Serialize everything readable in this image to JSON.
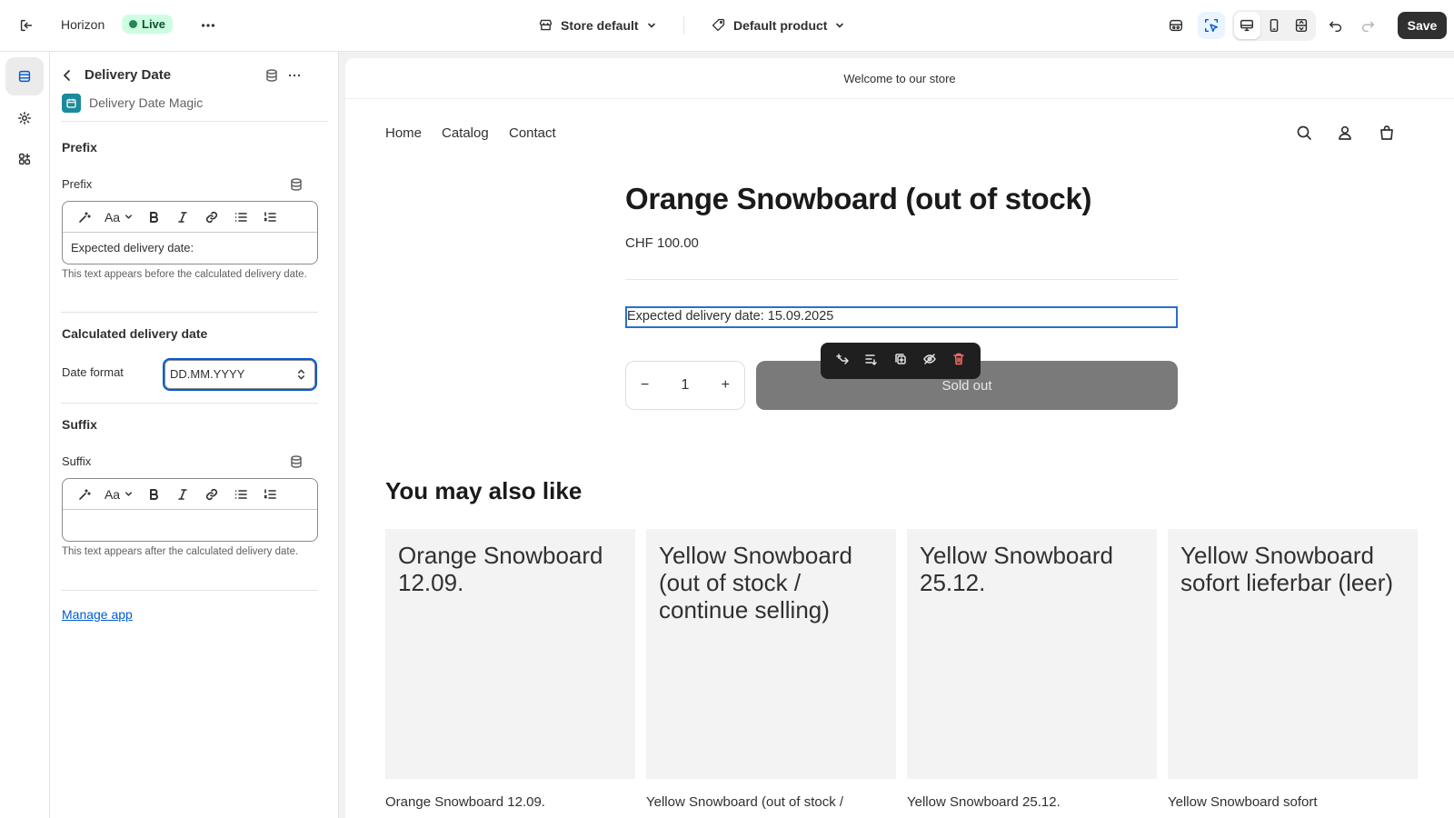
{
  "topbar": {
    "store_name": "Horizon",
    "status": "Live",
    "store_selector": "Store default",
    "template_selector": "Default product",
    "save_label": "Save"
  },
  "panel": {
    "title": "Delivery Date",
    "app_name": "Delivery Date Magic",
    "prefix": {
      "section_title": "Prefix",
      "field_label": "Prefix",
      "value": "Expected delivery date:",
      "help": "This text appears before the calculated delivery date."
    },
    "calculated": {
      "section_title": "Calculated delivery date",
      "field_label": "Date format",
      "value": "DD.MM.YYYY"
    },
    "suffix": {
      "section_title": "Suffix",
      "field_label": "Suffix",
      "value": "",
      "help": "This text appears after the calculated delivery date."
    },
    "manage_link": "Manage app"
  },
  "preview": {
    "announcement": "Welcome to our store",
    "nav": [
      "Home",
      "Catalog",
      "Contact"
    ],
    "product_title": "Orange Snowboard (out of stock)",
    "price": "CHF 100.00",
    "delivery_text": "Expected delivery date:  15.09.2025",
    "quantity": "1",
    "qty_minus": "−",
    "qty_plus": "+",
    "sold_out_label": "Sold out",
    "related_title": "You may also like",
    "products": [
      {
        "image_text": "Orange Snowboard 12.09.",
        "name": "Orange Snowboard 12.09."
      },
      {
        "image_text": "Yellow Snowboard (out of stock / continue selling)",
        "name": "Yellow Snowboard (out of stock /"
      },
      {
        "image_text": "Yellow Snowboard 25.12.",
        "name": "Yellow Snowboard 25.12."
      },
      {
        "image_text": "Yellow Snowboard sofort lieferbar (leer)",
        "name": "Yellow Snowboard sofort"
      }
    ]
  },
  "editor_toolbar": {
    "font_label": "Aa"
  }
}
